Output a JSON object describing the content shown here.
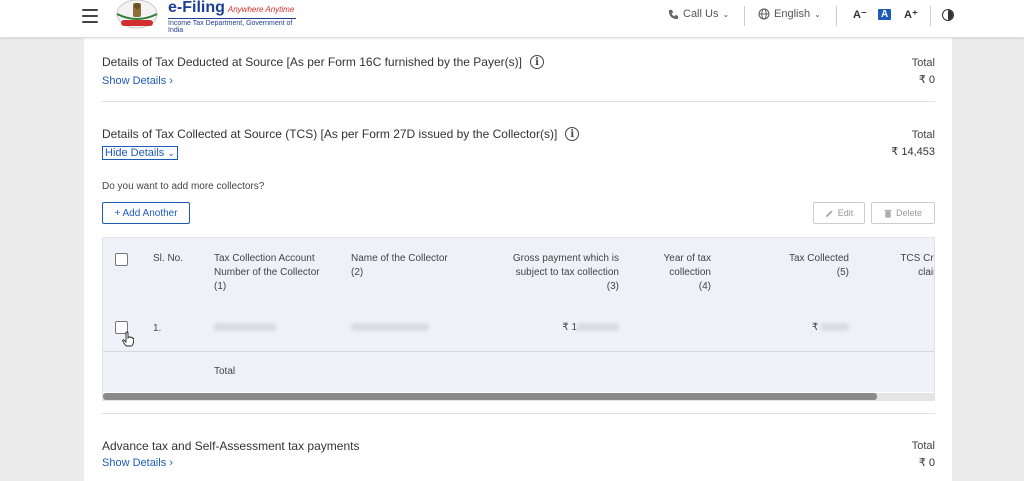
{
  "header": {
    "logo_title": "e-Filing",
    "logo_tagline": "Anywhere Anytime",
    "logo_subtitle": "Income Tax Department, Government of India",
    "call_us": "Call Us",
    "language": "English",
    "font_decrease": "A⁻",
    "font_default": "A",
    "font_increase": "A⁺"
  },
  "tds_section": {
    "title": "Details of Tax Deducted at Source [As per Form 16C furnished by the Payer(s)]",
    "link": "Show Details",
    "total_label": "Total",
    "total_value": "₹ 0"
  },
  "tcs_section": {
    "title": "Details of Tax Collected at Source (TCS) [As per Form 27D issued by the Collector(s)]",
    "link": "Hide Details",
    "total_label": "Total",
    "total_value": "₹ 14,453",
    "question": "Do you want to add more collectors?",
    "add_button": "+ Add Another",
    "edit_button": "Edit",
    "delete_button": "Delete",
    "table": {
      "headers": {
        "sl_no": "Sl. No.",
        "tan_1": "Tax Collection Account",
        "tan_2": "Number of the Collector",
        "tan_3": "(1)",
        "name_1": "Name of the Collector",
        "name_2": "(2)",
        "gross_1": "Gross payment which is",
        "gross_2": "subject to tax collection",
        "gross_3": "(3)",
        "year_1": "Year of tax",
        "year_2": "collection",
        "year_3": "(4)",
        "collected_1": "Tax Collected",
        "collected_2": "(5)",
        "tcs_1": "TCS Credi",
        "tcs_2": "claime"
      },
      "rows": [
        {
          "sl": "1.",
          "gross_prefix": "₹ 1",
          "collected_prefix": "₹"
        }
      ],
      "total_label": "Total",
      "scroll_position": 0
    }
  },
  "advance_section": {
    "title": "Advance tax and Self-Assessment tax payments",
    "link": "Show Details",
    "total_label": "Total",
    "total_value": "₹ 0"
  }
}
